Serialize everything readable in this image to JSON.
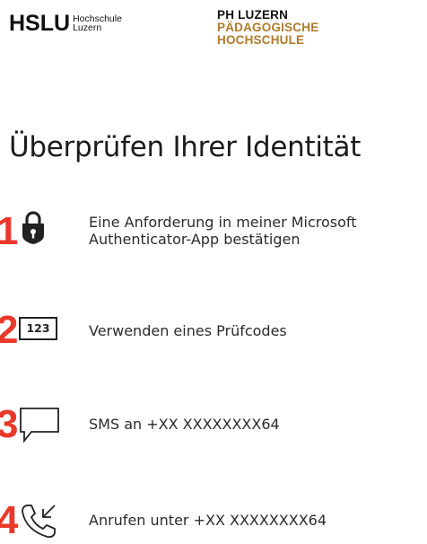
{
  "logos": {
    "hslu": {
      "big": "HSLU",
      "small_line1": "Hochschule",
      "small_line2": "Luzern"
    },
    "ph": {
      "line1": "PH LUZERN",
      "line2": "PÄDAGOGISCHE",
      "line3": "HOCHSCHULE"
    }
  },
  "title": "Überprüfen Ihrer Identität",
  "accent_color": "#e8392b",
  "options": [
    {
      "number": "1",
      "icon": "lock-icon",
      "label_line1": "Eine Anforderung in meiner Microsoft",
      "label_line2": "Authenticator-App bestätigen"
    },
    {
      "number": "2",
      "icon": "code-123-icon",
      "icon_text": "123",
      "label_line1": "Verwenden eines Prüfcodes"
    },
    {
      "number": "3",
      "icon": "chat-bubble-icon",
      "label_line1": "SMS an +XX XXXXXXXX64"
    },
    {
      "number": "4",
      "icon": "phone-incoming-icon",
      "label_line1": "Anrufen unter +XX XXXXXXXX64"
    }
  ]
}
